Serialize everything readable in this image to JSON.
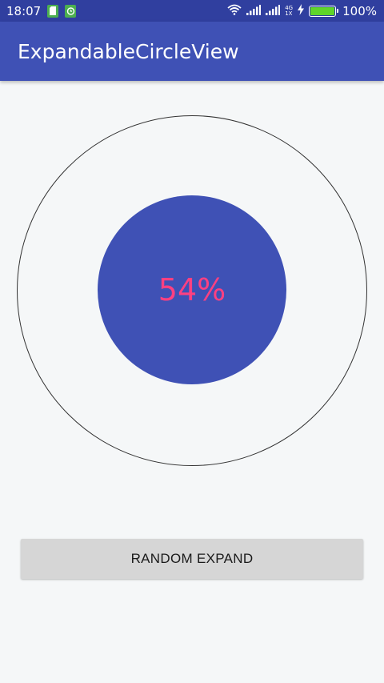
{
  "status_bar": {
    "time": "18:07",
    "battery_text": "100%",
    "network_type_top": "4G",
    "network_type_bottom": "1X",
    "icons": [
      "sim-notification-icon",
      "alarm-notification-icon",
      "wifi-icon",
      "signal-icon",
      "signal-2-icon",
      "charging-icon",
      "battery-icon"
    ],
    "battery_level": 1.0
  },
  "app_bar": {
    "title": "ExpandableCircleView"
  },
  "circle": {
    "percent_label": "54%",
    "expand_fraction": 0.54,
    "inner_color": "#3f51b5",
    "text_color": "#ff4081",
    "outline_color": "#333333"
  },
  "button": {
    "label": "RANDOM EXPAND"
  },
  "colors": {
    "primary_dark": "#303f9f",
    "primary": "#3f51b5",
    "accent": "#ff4081",
    "battery": "#5fd42a"
  }
}
